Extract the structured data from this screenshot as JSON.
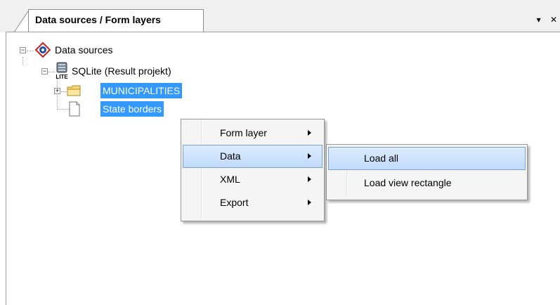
{
  "pane": {
    "tab_title": "Data sources / Form layers",
    "dropdown_glyph": "▾",
    "close_glyph": "✕"
  },
  "tree": {
    "root": {
      "label": "Data sources",
      "icon": "data-sources-icon"
    },
    "connection": {
      "label": "SQLite (Result projekt)",
      "icon": "database-lite-icon",
      "icon_text": "LITE"
    },
    "items": [
      {
        "label": "MUNICIPALITIES",
        "icon": "folder-icon",
        "selected": true
      },
      {
        "label": "State borders",
        "icon": "document-icon",
        "selected": true
      }
    ]
  },
  "context_menu": {
    "items": [
      {
        "label": "Form layer",
        "has_submenu": true
      },
      {
        "label": "Data",
        "has_submenu": true,
        "highlighted": true
      },
      {
        "label": "XML",
        "has_submenu": true
      },
      {
        "label": "Export",
        "has_submenu": true
      }
    ]
  },
  "submenu": {
    "items": [
      {
        "label": "Load all",
        "highlighted": true
      },
      {
        "label": "Load view rectangle"
      }
    ]
  },
  "colors": {
    "selection": "#3399ff",
    "menu_highlight": "#c1dbfc"
  }
}
